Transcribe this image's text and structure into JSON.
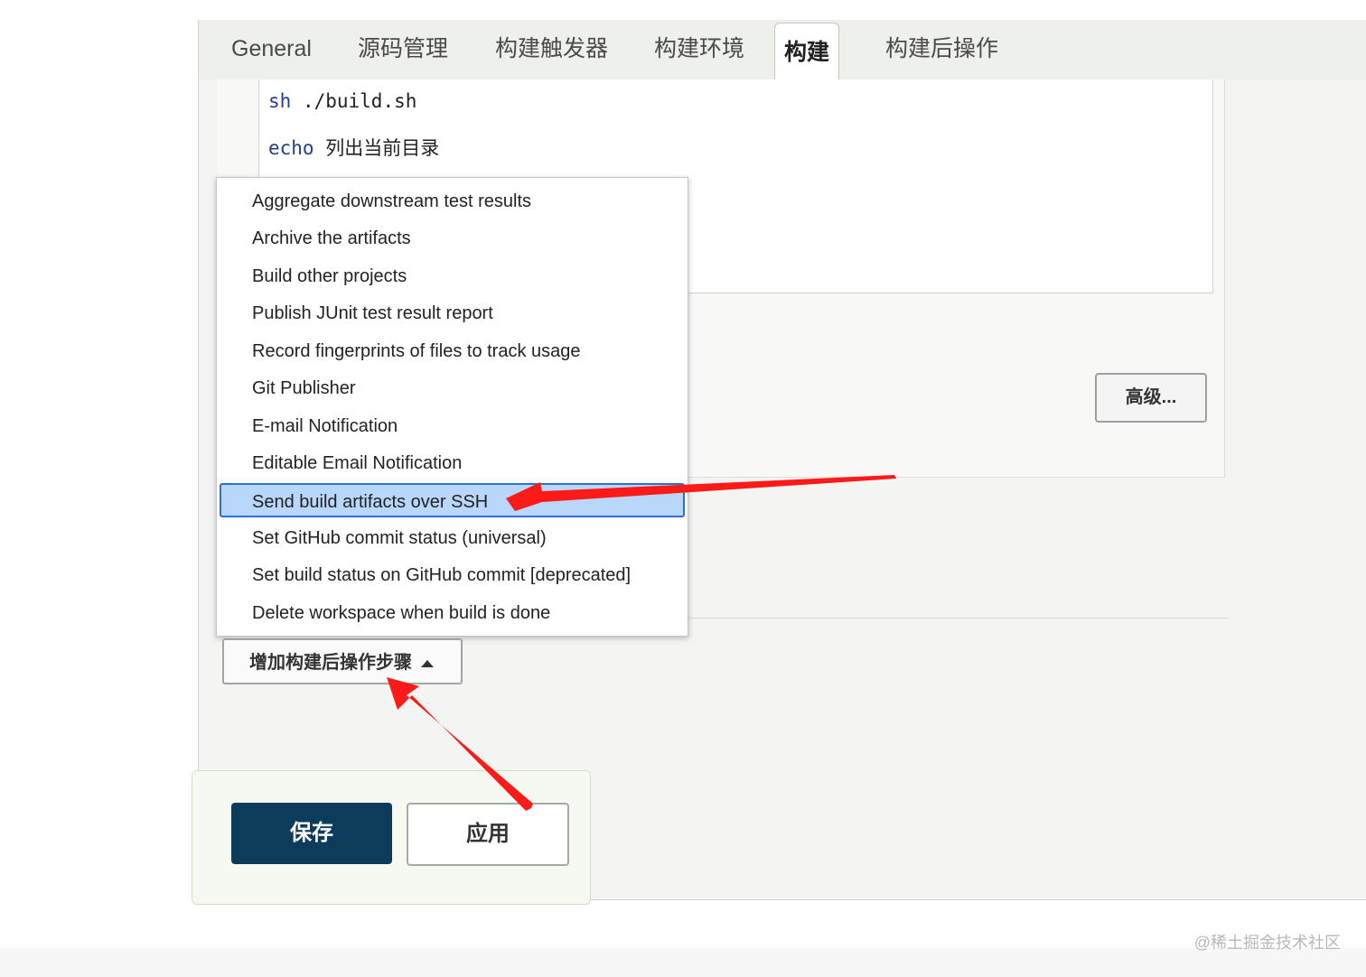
{
  "tabs": [
    {
      "label": "General"
    },
    {
      "label": "源码管理"
    },
    {
      "label": "构建触发器"
    },
    {
      "label": "构建环境"
    },
    {
      "label": "构建"
    },
    {
      "label": "构建后操作"
    }
  ],
  "editor": {
    "line1_cmd": "sh",
    "line1_arg": "./build.sh",
    "line2_cmd": "echo",
    "line2_arg": "列出当前目录"
  },
  "advanced_button": "高级...",
  "menu": {
    "items": [
      {
        "label": "Aggregate downstream test results"
      },
      {
        "label": "Archive the artifacts"
      },
      {
        "label": "Build other projects"
      },
      {
        "label": "Publish JUnit test result report"
      },
      {
        "label": "Record fingerprints of files to track usage"
      },
      {
        "label": "Git Publisher"
      },
      {
        "label": "E-mail Notification"
      },
      {
        "label": "Editable Email Notification"
      },
      {
        "label": "Send build artifacts over SSH"
      },
      {
        "label": "Set GitHub commit status (universal)"
      },
      {
        "label": "Set build status on GitHub commit [deprecated]"
      },
      {
        "label": "Delete workspace when build is done"
      }
    ]
  },
  "add_step_button": "增加构建后操作步骤",
  "save_button": "保存",
  "apply_button": "应用",
  "watermark": "@稀土掘金技术社区",
  "colors": {
    "save_bg": "#0d3b5c",
    "selection_bg": "#b9d7fb",
    "selection_border": "#2f6fd1",
    "annotation_arrow": "#ff1a1a"
  }
}
